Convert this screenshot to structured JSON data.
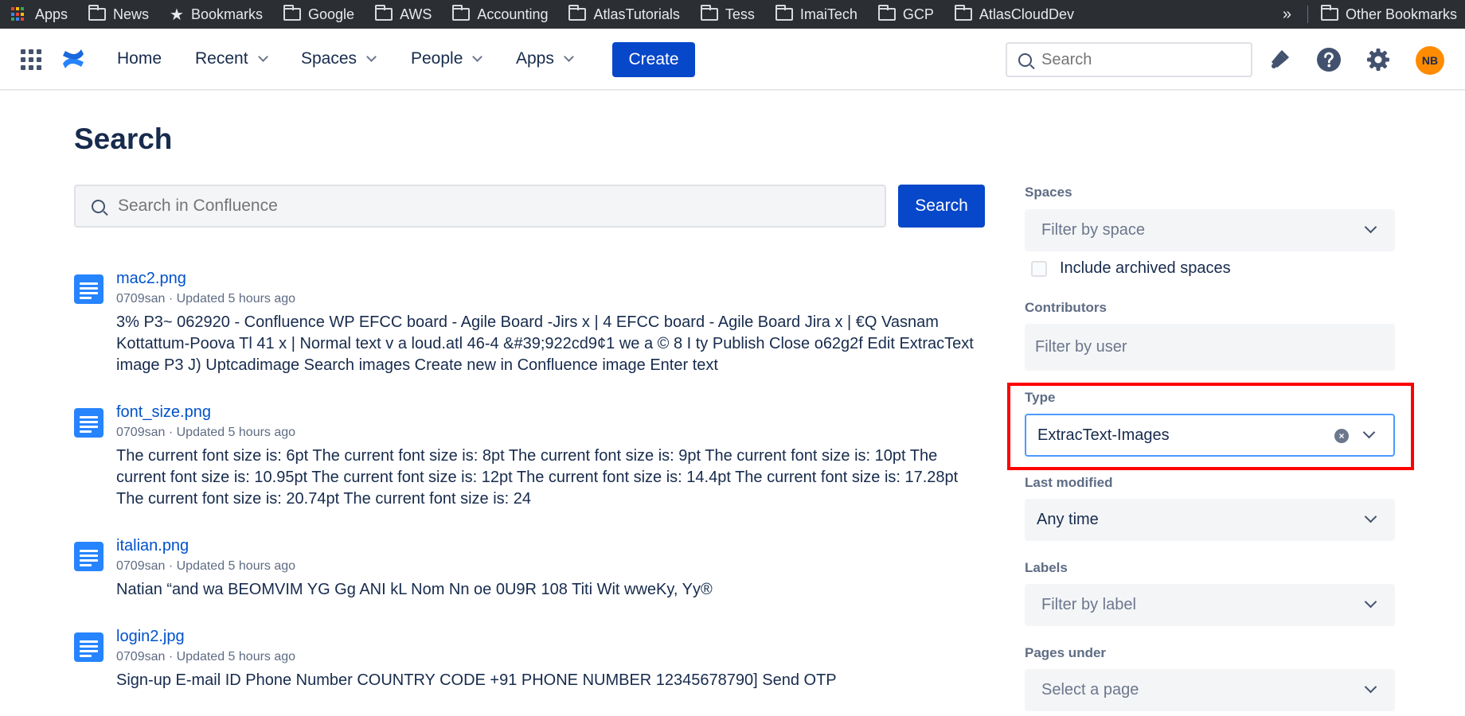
{
  "bookmarks": {
    "items": [
      {
        "label": "Apps",
        "icon": "apps-grid-icon"
      },
      {
        "label": "News",
        "icon": "folder-icon"
      },
      {
        "label": "Bookmarks",
        "icon": "star-icon"
      },
      {
        "label": "Google",
        "icon": "folder-icon"
      },
      {
        "label": "AWS",
        "icon": "folder-icon"
      },
      {
        "label": "Accounting",
        "icon": "folder-icon"
      },
      {
        "label": "AtlasTutorials",
        "icon": "folder-icon"
      },
      {
        "label": "Tess",
        "icon": "folder-icon"
      },
      {
        "label": "ImaiTech",
        "icon": "folder-icon"
      },
      {
        "label": "GCP",
        "icon": "folder-icon"
      },
      {
        "label": "AtlasCloudDev",
        "icon": "folder-icon"
      }
    ],
    "more": "»",
    "other": "Other Bookmarks"
  },
  "nav": {
    "home": "Home",
    "recent": "Recent",
    "spaces": "Spaces",
    "people": "People",
    "apps": "Apps",
    "create": "Create",
    "search_placeholder": "Search",
    "avatar_initials": "NB"
  },
  "page": {
    "title": "Search",
    "search_placeholder": "Search in Confluence",
    "search_button": "Search"
  },
  "results": [
    {
      "title": "mac2.png",
      "meta": "0709san · Updated 5 hours ago",
      "snippet": "3% P3~ 062920 - Confluence WP EFCC board - Agile Board -Jirs x | 4 EFCC board - Agile Board Jira x | €Q Vasnam Kottattum-Poova Tl 41 x | Normal text v a loud.atl 46-4 &#39;922cd9¢1 we a © 8 I ty Publish Close o62g2f Edit ExtracText image P3 J) Uptcadimage Search images Create new in Confluence image Enter text"
    },
    {
      "title": "font_size.png",
      "meta": "0709san · Updated 5 hours ago",
      "snippet": "The current font size is: 6pt The current font size is: 8pt The current font size is: 9pt The current font size is: 10pt The current font size is: 10.95pt The current font size is: 12pt The current font size is: 14.4pt The current font size is: 17.28pt The current font size is: 20.74pt The current font size is: 24"
    },
    {
      "title": "italian.png",
      "meta": "0709san · Updated 5 hours ago",
      "snippet": "Natian “and wa BEOMVIM YG Gg ANI kL Nom Nn oe 0U9R 108 Titi Wit wweKy, Yy®"
    },
    {
      "title": "login2.jpg",
      "meta": "0709san · Updated 5 hours ago",
      "snippet": "Sign-up E-mail ID Phone Number COUNTRY CODE +91 PHONE NUMBER 12345678790] Send OTP"
    }
  ],
  "filters": {
    "spaces_label": "Spaces",
    "spaces_placeholder": "Filter by space",
    "include_archived": "Include archived spaces",
    "contributors_label": "Contributors",
    "contributors_placeholder": "Filter by user",
    "type_label": "Type",
    "type_value": "ExtracText-Images",
    "last_modified_label": "Last modified",
    "last_modified_value": "Any time",
    "labels_label": "Labels",
    "labels_placeholder": "Filter by label",
    "pages_under_label": "Pages under",
    "pages_under_placeholder": "Select a page"
  },
  "colors": {
    "primary": "#0747c9",
    "link": "#0052cc",
    "highlight": "#ff0000",
    "avatar": "#ff8b00"
  }
}
